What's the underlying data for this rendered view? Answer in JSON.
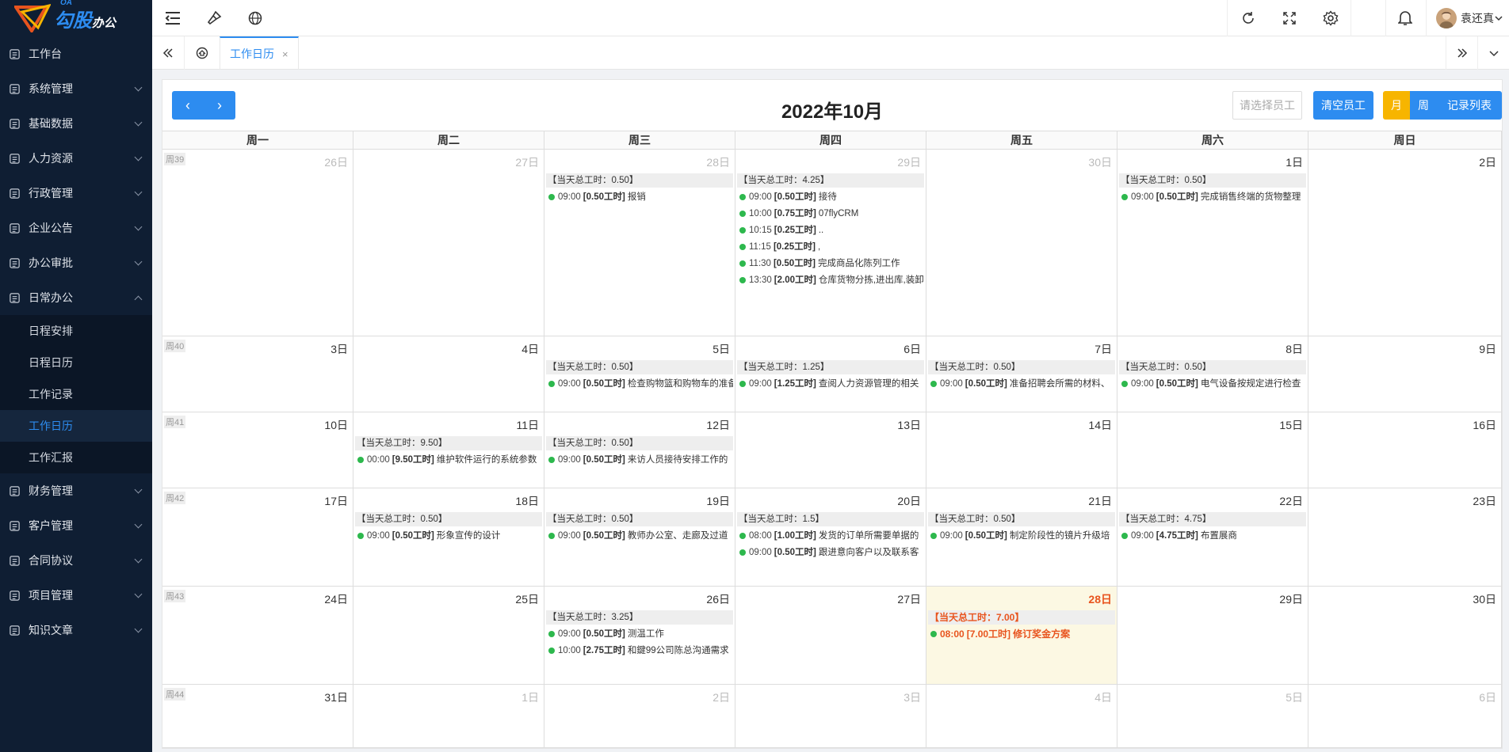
{
  "logo": {
    "text": "勾股",
    "sub": "办公",
    "oa": "OA"
  },
  "sidebar": {
    "items": [
      {
        "label": "工作台",
        "icon": "dashboard-icon",
        "arrow": false
      },
      {
        "label": "系统管理",
        "icon": "settings-icon",
        "arrow": true
      },
      {
        "label": "基础数据",
        "icon": "database-icon",
        "arrow": true
      },
      {
        "label": "人力资源",
        "icon": "person-card-icon",
        "arrow": true
      },
      {
        "label": "行政管理",
        "icon": "admin-icon",
        "arrow": true
      },
      {
        "label": "企业公告",
        "icon": "bell-icon",
        "arrow": true
      },
      {
        "label": "办公审批",
        "icon": "approval-icon",
        "arrow": true
      },
      {
        "label": "日常办公",
        "icon": "calendar-icon",
        "arrow": true,
        "open": true
      }
    ],
    "submenu": [
      {
        "label": "日程安排",
        "active": false
      },
      {
        "label": "日程日历",
        "active": false
      },
      {
        "label": "工作记录",
        "active": false
      },
      {
        "label": "工作日历",
        "active": true
      },
      {
        "label": "工作汇报",
        "active": false
      }
    ],
    "items_after": [
      {
        "label": "财务管理",
        "icon": "finance-icon"
      },
      {
        "label": "客户管理",
        "icon": "customer-icon"
      },
      {
        "label": "合同协议",
        "icon": "contract-icon"
      },
      {
        "label": "项目管理",
        "icon": "project-icon"
      },
      {
        "label": "知识文章",
        "icon": "article-icon"
      }
    ]
  },
  "topbar": {
    "user": "袁还真"
  },
  "tabs": {
    "active": "工作日历",
    "close": "×"
  },
  "calendar": {
    "title": "2022年10月",
    "prev": "‹",
    "next": "›",
    "employee_placeholder": "请选择员工",
    "clear_label": "清空员工",
    "views": {
      "month": "月",
      "week": "周",
      "list": "记录列表"
    },
    "dow": [
      "周一",
      "周二",
      "周三",
      "周四",
      "周五",
      "周六",
      "周日"
    ],
    "weeks": [
      {
        "label": "周39",
        "days": [
          {
            "d": "26日",
            "other": true
          },
          {
            "d": "27日",
            "other": true
          },
          {
            "d": "28日",
            "other": true,
            "total": "【当天总工时：0.50】",
            "events": [
              {
                "t": "09:00",
                "h": "[0.50工时]",
                "s": "报销"
              }
            ]
          },
          {
            "d": "29日",
            "other": true,
            "total": "【当天总工时：4.25】",
            "events": [
              {
                "t": "09:00",
                "h": "[0.50工时]",
                "s": "接待"
              },
              {
                "t": "10:00",
                "h": "[0.75工时]",
                "s": "07flyCRM"
              },
              {
                "t": "10:15",
                "h": "[0.25工时]",
                "s": ".."
              },
              {
                "t": "11:15",
                "h": "[0.25工时]",
                "s": ","
              },
              {
                "t": "11:30",
                "h": "[0.50工时]",
                "s": "完成商品化陈列工作"
              },
              {
                "t": "13:30",
                "h": "[2.00工时]",
                "s": "仓库货物分拣,进出库,装卸"
              }
            ]
          },
          {
            "d": "30日",
            "other": true
          },
          {
            "d": "1日",
            "total": "【当天总工时：0.50】",
            "events": [
              {
                "t": "09:00",
                "h": "[0.50工时]",
                "s": "完成销售终端的货物整理"
              }
            ]
          },
          {
            "d": "2日"
          }
        ]
      },
      {
        "label": "周40",
        "days": [
          {
            "d": "3日"
          },
          {
            "d": "4日"
          },
          {
            "d": "5日",
            "total": "【当天总工时：0.50】",
            "events": [
              {
                "t": "09:00",
                "h": "[0.50工时]",
                "s": "检查购物篮和购物车的准备"
              }
            ]
          },
          {
            "d": "6日",
            "total": "【当天总工时：1.25】",
            "events": [
              {
                "t": "09:00",
                "h": "[1.25工时]",
                "s": "查阅人力资源管理的相关"
              }
            ]
          },
          {
            "d": "7日",
            "total": "【当天总工时：0.50】",
            "events": [
              {
                "t": "09:00",
                "h": "[0.50工时]",
                "s": "准备招聘会所需的材料、"
              }
            ]
          },
          {
            "d": "8日",
            "total": "【当天总工时：0.50】",
            "events": [
              {
                "t": "09:00",
                "h": "[0.50工时]",
                "s": "电气设备按规定进行检查"
              }
            ]
          },
          {
            "d": "9日"
          }
        ]
      },
      {
        "label": "周41",
        "days": [
          {
            "d": "10日"
          },
          {
            "d": "11日",
            "total": "【当天总工时：9.50】",
            "events": [
              {
                "t": "00:00",
                "h": "[9.50工时]",
                "s": "维护软件运行的系统参数"
              }
            ]
          },
          {
            "d": "12日",
            "total": "【当天总工时：0.50】",
            "events": [
              {
                "t": "09:00",
                "h": "[0.50工时]",
                "s": "来访人员接待安排工作的"
              }
            ]
          },
          {
            "d": "13日"
          },
          {
            "d": "14日"
          },
          {
            "d": "15日"
          },
          {
            "d": "16日"
          }
        ]
      },
      {
        "label": "周42",
        "days": [
          {
            "d": "17日"
          },
          {
            "d": "18日",
            "total": "【当天总工时：0.50】",
            "events": [
              {
                "t": "09:00",
                "h": "[0.50工时]",
                "s": "形象宣传的设计"
              }
            ]
          },
          {
            "d": "19日",
            "total": "【当天总工时：0.50】",
            "events": [
              {
                "t": "09:00",
                "h": "[0.50工时]",
                "s": "教师办公室、走廊及过道"
              }
            ]
          },
          {
            "d": "20日",
            "total": "【当天总工时：1.5】",
            "events": [
              {
                "t": "08:00",
                "h": "[1.00工时]",
                "s": "发货的订单所需要单据的"
              },
              {
                "t": "09:00",
                "h": "[0.50工时]",
                "s": "跟进意向客户以及联系客"
              }
            ]
          },
          {
            "d": "21日",
            "total": "【当天总工时：0.50】",
            "events": [
              {
                "t": "09:00",
                "h": "[0.50工时]",
                "s": "制定阶段性的镜片升级培"
              }
            ]
          },
          {
            "d": "22日",
            "total": "【当天总工时：4.75】",
            "events": [
              {
                "t": "09:00",
                "h": "[4.75工时]",
                "s": "布置展商"
              }
            ]
          },
          {
            "d": "23日"
          }
        ]
      },
      {
        "label": "周43",
        "days": [
          {
            "d": "24日"
          },
          {
            "d": "25日"
          },
          {
            "d": "26日",
            "total": "【当天总工时：3.25】",
            "events": [
              {
                "t": "09:00",
                "h": "[0.50工时]",
                "s": "测温工作"
              },
              {
                "t": "10:00",
                "h": "[2.75工时]",
                "s": "和鍵99公司陈总沟通需求"
              }
            ]
          },
          {
            "d": "27日"
          },
          {
            "d": "28日",
            "today": true,
            "total": "【当天总工时：7.00】",
            "events": [
              {
                "t": "08:00",
                "h": "[7.00工时]",
                "s": "修订奖金方案"
              }
            ]
          },
          {
            "d": "29日"
          },
          {
            "d": "30日"
          }
        ]
      },
      {
        "label": "周44",
        "days": [
          {
            "d": "31日"
          },
          {
            "d": "1日",
            "other": true
          },
          {
            "d": "2日",
            "other": true
          },
          {
            "d": "3日",
            "other": true
          },
          {
            "d": "4日",
            "other": true
          },
          {
            "d": "5日",
            "other": true
          },
          {
            "d": "6日",
            "other": true
          }
        ]
      }
    ]
  }
}
